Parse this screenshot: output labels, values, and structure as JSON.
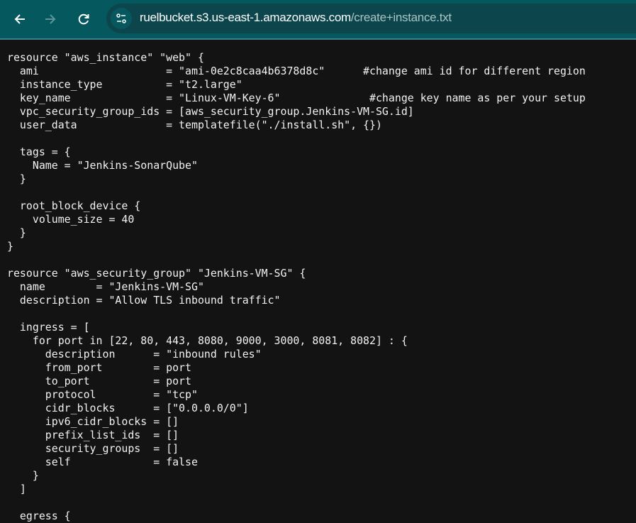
{
  "browser": {
    "url_host": "ruelbucket.s3.us-east-1.amazonaws.com",
    "url_path": "/create+instance.txt",
    "icons": [
      "back-arrow-icon",
      "forward-arrow-icon",
      "reload-icon",
      "site-info-icon"
    ],
    "colors": {
      "toolbar": "#04585e",
      "url_pill": "#0c464c",
      "page_background": "#131313",
      "text": "#f2f2f2"
    }
  },
  "file": {
    "lines": [
      "resource \"aws_instance\" \"web\" {",
      "  ami                    = \"ami-0e2c8caa4b6378d8c\"      #change ami id for different region",
      "  instance_type          = \"t2.large\"",
      "  key_name               = \"Linux-VM-Key-6\"              #change key name as per your setup",
      "  vpc_security_group_ids = [aws_security_group.Jenkins-VM-SG.id]",
      "  user_data              = templatefile(\"./install.sh\", {})",
      "",
      "  tags = {",
      "    Name = \"Jenkins-SonarQube\"",
      "  }",
      "",
      "  root_block_device {",
      "    volume_size = 40",
      "  }",
      "}",
      "",
      "resource \"aws_security_group\" \"Jenkins-VM-SG\" {",
      "  name        = \"Jenkins-VM-SG\"",
      "  description = \"Allow TLS inbound traffic\"",
      "",
      "  ingress = [",
      "    for port in [22, 80, 443, 8080, 9000, 3000, 8081, 8082] : {",
      "      description      = \"inbound rules\"",
      "      from_port        = port",
      "      to_port          = port",
      "      protocol         = \"tcp\"",
      "      cidr_blocks      = [\"0.0.0.0/0\"]",
      "      ipv6_cidr_blocks = []",
      "      prefix_list_ids  = []",
      "      security_groups  = []",
      "      self             = false",
      "    }",
      "  ]",
      "",
      "  egress {"
    ]
  }
}
